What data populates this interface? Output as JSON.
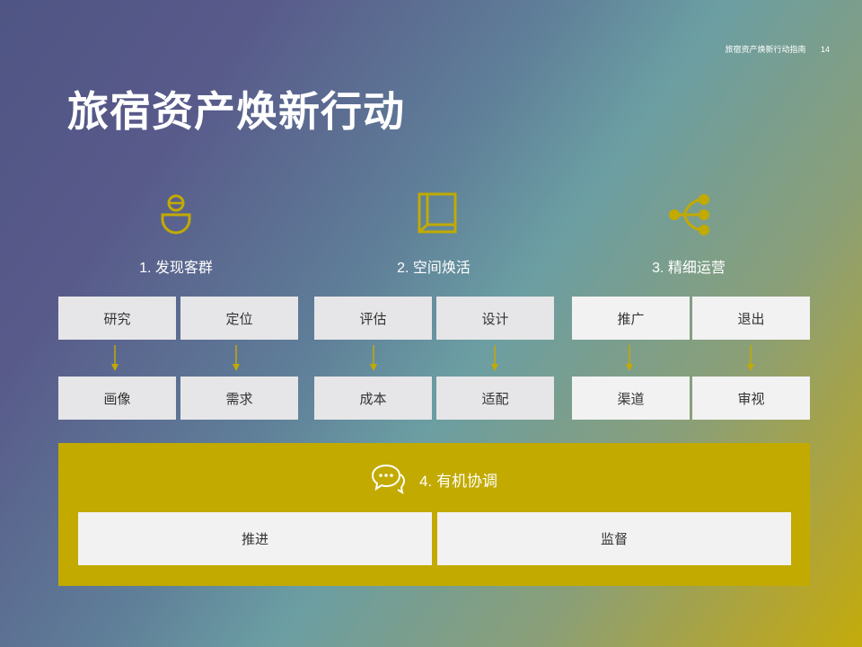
{
  "header": {
    "doc_title": "旅宿资产焕新行动指南",
    "page_number": "14"
  },
  "title": "旅宿资产焕新行动",
  "accent_color": "#c2aa00",
  "steps": [
    {
      "icon": "person-icon",
      "label": "1. 发现客群",
      "top_boxes": [
        "研究",
        "定位"
      ],
      "bottom_boxes": [
        "画像",
        "需求"
      ]
    },
    {
      "icon": "book-icon",
      "label": "2. 空间焕活",
      "top_boxes": [
        "评估",
        "设计"
      ],
      "bottom_boxes": [
        "成本",
        "适配"
      ]
    },
    {
      "icon": "network-icon",
      "label": "3. 精细运营",
      "top_boxes": [
        "推广",
        "退出"
      ],
      "bottom_boxes": [
        "渠道",
        "审视"
      ]
    }
  ],
  "coordination": {
    "icon": "chat-bubbles-icon",
    "label": "4. 有机协调",
    "boxes": [
      "推进",
      "监督"
    ]
  }
}
